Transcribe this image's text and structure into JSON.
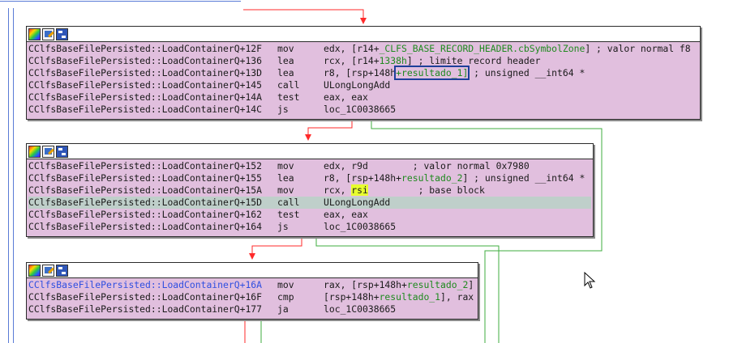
{
  "header_icons": [
    "palette-icon",
    "edit-icon",
    "graph-icon"
  ],
  "colors": {
    "block_bg": "#e1bfde",
    "edge_red": "#ff2a2a",
    "edge_green": "#3fae3f",
    "edge_blue": "#5a7bd6",
    "label_green": "#1f8a1f",
    "highlight_yellow": "#e7ff2e"
  },
  "blocks": [
    {
      "lines": [
        {
          "addr": "CClfsBaseFilePersisted::LoadContainerQ+12F",
          "mnem": "mov",
          "ops": [
            "edx, [r14+",
            {
              "g": "_CLFS_BASE_RECORD_HEADER.cbSymbolZone"
            },
            "] ; valor normal f8"
          ]
        },
        {
          "addr": "CClfsBaseFilePersisted::LoadContainerQ+136",
          "mnem": "lea",
          "ops": [
            "rcx, [r14+",
            {
              "g": "1338h"
            },
            "] ; limite record header"
          ]
        },
        {
          "addr": "CClfsBaseFilePersisted::LoadContainerQ+13D",
          "mnem": "lea",
          "ops": [
            "r8, [rsp+148h",
            {
              "box": "+resultado_1]"
            },
            " ; unsigned __int64 *"
          ]
        },
        {
          "addr": "CClfsBaseFilePersisted::LoadContainerQ+145",
          "mnem": "call",
          "ops": [
            "ULongLongAdd"
          ]
        },
        {
          "addr": "CClfsBaseFilePersisted::LoadContainerQ+14A",
          "mnem": "test",
          "ops": [
            "eax, eax"
          ]
        },
        {
          "addr": "CClfsBaseFilePersisted::LoadContainerQ+14C",
          "mnem": "js",
          "ops": [
            "loc_1C0038665"
          ]
        }
      ]
    },
    {
      "lines": [
        {
          "addr": "CClfsBaseFilePersisted::LoadContainerQ+152",
          "mnem": "mov",
          "ops": [
            "edx, r9d        ; valor normal 0x7980"
          ]
        },
        {
          "addr": "CClfsBaseFilePersisted::LoadContainerQ+155",
          "mnem": "lea",
          "ops": [
            "r8, [rsp+148h+",
            {
              "g": "resultado_2"
            },
            "] ; unsigned __int64 *"
          ]
        },
        {
          "addr": "CClfsBaseFilePersisted::LoadContainerQ+15A",
          "mnem": "mov",
          "ops": [
            "rcx, ",
            {
              "y": "rsi"
            },
            "         ; base block"
          ]
        },
        {
          "addr": "CClfsBaseFilePersisted::LoadContainerQ+15D",
          "mnem": "call",
          "ops": [
            "ULongLongAdd"
          ],
          "selected": true
        },
        {
          "addr": "CClfsBaseFilePersisted::LoadContainerQ+162",
          "mnem": "test",
          "ops": [
            "eax, eax"
          ]
        },
        {
          "addr": "CClfsBaseFilePersisted::LoadContainerQ+164",
          "mnem": "js",
          "ops": [
            "loc_1C0038665"
          ]
        }
      ]
    },
    {
      "lines": [
        {
          "addr": "CClfsBaseFilePersisted::LoadContainerQ+16A",
          "mnem": "mov",
          "ops": [
            "rax, [rsp+148h+",
            {
              "g": "resultado_2"
            },
            "]"
          ],
          "addr_highlight": true
        },
        {
          "addr": "CClfsBaseFilePersisted::LoadContainerQ+16F",
          "mnem": "cmp",
          "ops": [
            "[rsp+148h+",
            {
              "g": "resultado_1"
            },
            "], rax"
          ]
        },
        {
          "addr": "CClfsBaseFilePersisted::LoadContainerQ+177",
          "mnem": "ja",
          "ops": [
            "loc_1C0038665"
          ]
        }
      ]
    }
  ]
}
